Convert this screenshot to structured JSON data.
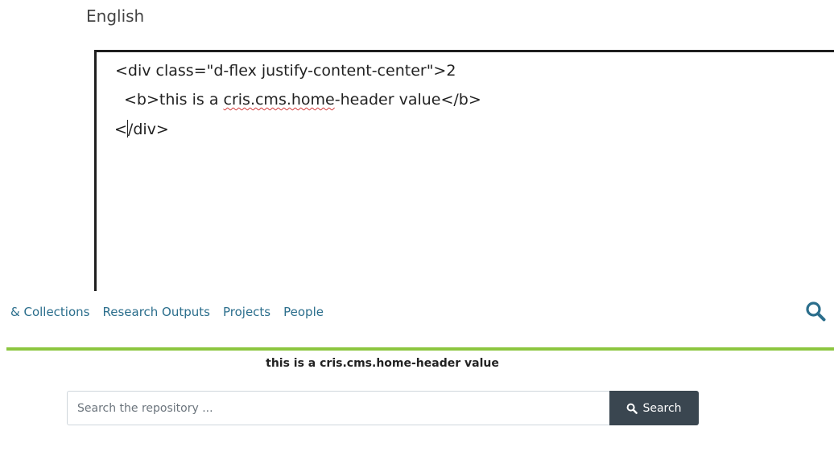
{
  "editor": {
    "language": "English",
    "lines": [
      "<div class=\"d-flex justify-content-center\">2",
      "<b>this is a ",
      "cris.cms.home",
      "-header value</b>",
      "/div>"
    ],
    "line3_prefix": "<"
  },
  "navbar": {
    "links": [
      "& Collections",
      "Research Outputs",
      "Projects",
      "People"
    ]
  },
  "home_header": "this is a cris.cms.home-header value",
  "search": {
    "placeholder": "Search the repository ...",
    "button_label": "Search"
  },
  "colors": {
    "accent_rule": "#8cc63f",
    "nav_link": "#2b6e8c",
    "search_button": "#3a4650"
  },
  "icons": {
    "navbar_search": "search-icon",
    "button_search": "search-icon"
  }
}
